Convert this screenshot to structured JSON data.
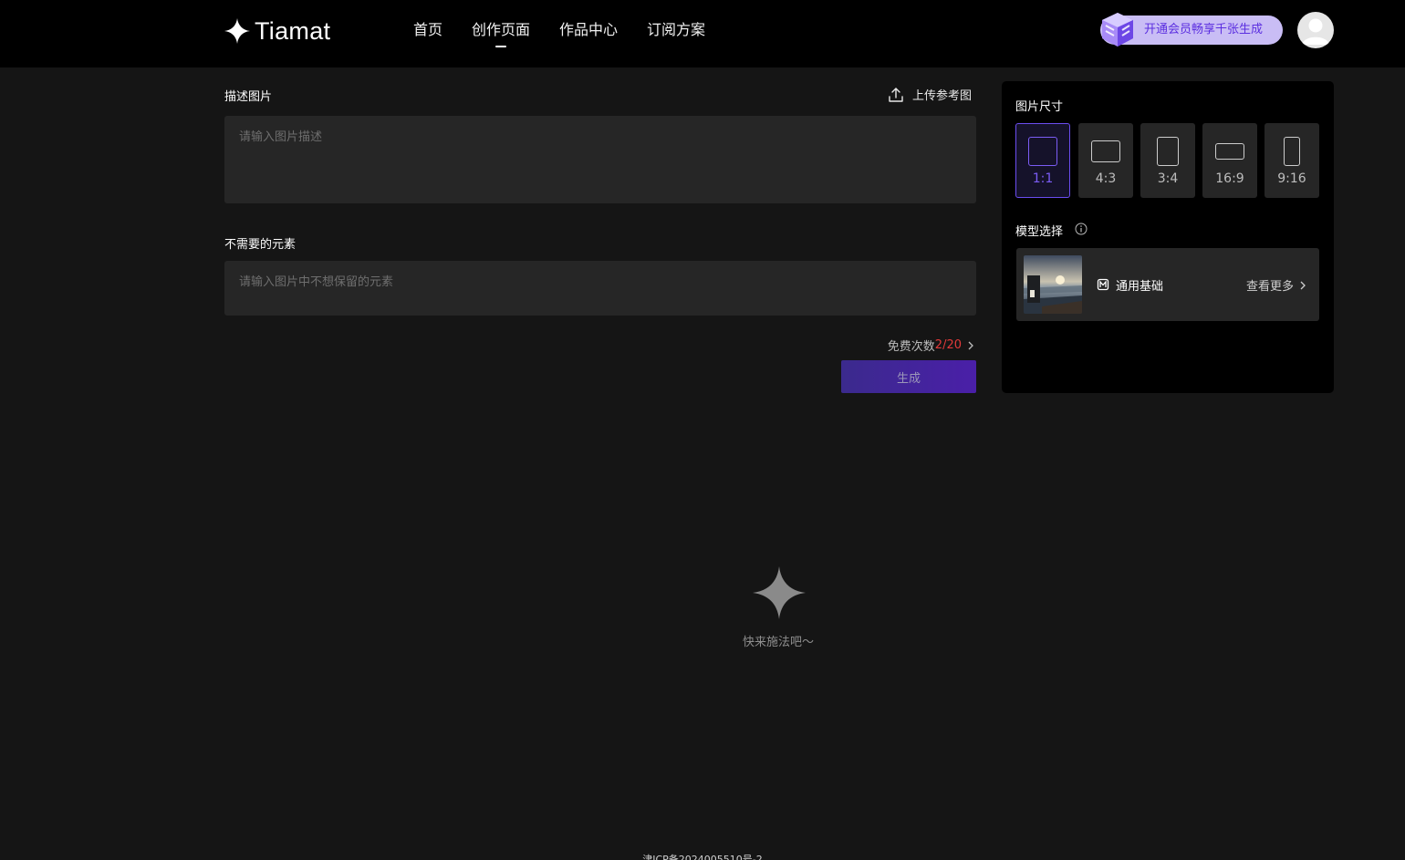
{
  "header": {
    "logo_text": "Tiamat",
    "nav": [
      {
        "label": "首页"
      },
      {
        "label": "创作页面"
      },
      {
        "label": "作品中心"
      },
      {
        "label": "订阅方案"
      }
    ],
    "active_nav": "创作页面",
    "vip_text": "开通会员畅享千张生成"
  },
  "form": {
    "describe_label": "描述图片",
    "upload_label": "上传参考图",
    "describe_placeholder": "请输入图片描述",
    "negative_label": "不需要的元素",
    "negative_placeholder": "请输入图片中不想保留的元素",
    "free_prefix": "免费次数",
    "free_count": "2/20",
    "generate_label": "生成"
  },
  "panel": {
    "size_label": "图片尺寸",
    "ratios": [
      "1:1",
      "4:3",
      "3:4",
      "16:9",
      "9:16"
    ],
    "selected_ratio": "1:1",
    "model_label": "模型选择",
    "model_name": "通用基础",
    "more_label": "查看更多"
  },
  "empty": {
    "text": "快来施法吧～"
  },
  "footer": {
    "text": "津ICP备2024005510号-2"
  },
  "colors": {
    "accent": "#6b4df0",
    "count": "#e23a3a",
    "background": "#151515",
    "topbar": "#000000"
  }
}
